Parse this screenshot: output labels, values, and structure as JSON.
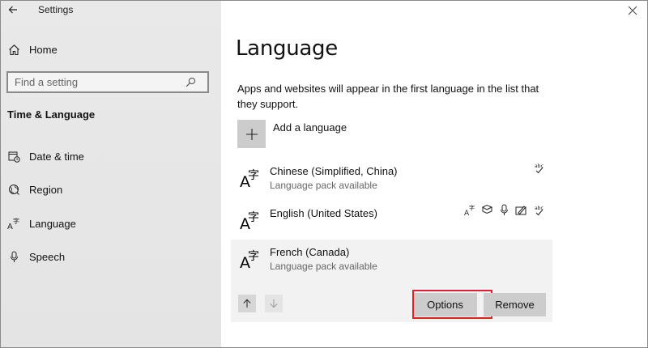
{
  "window": {
    "app_title": "Settings"
  },
  "sidebar": {
    "home_label": "Home",
    "search_placeholder": "Find a setting",
    "section_title": "Time & Language",
    "items": [
      {
        "label": "Date & time",
        "icon": "calendar-clock-icon"
      },
      {
        "label": "Region",
        "icon": "globe-icon"
      },
      {
        "label": "Language",
        "icon": "language-icon"
      },
      {
        "label": "Speech",
        "icon": "microphone-icon"
      }
    ]
  },
  "main": {
    "page_title": "Language",
    "description": "Apps and websites will appear in the first language in the list that they support.",
    "add_language_label": "Add a language",
    "languages": [
      {
        "name": "Chinese (Simplified, China)",
        "status": "Language pack available",
        "features": [
          "spelling-icon"
        ]
      },
      {
        "name": "English (United States)",
        "status": "",
        "features": [
          "display-language-icon",
          "speech-icon",
          "microphone-icon",
          "handwriting-icon",
          "spelling-icon"
        ]
      },
      {
        "name": "French (Canada)",
        "status": "Language pack available",
        "features": [],
        "selected": true
      }
    ],
    "actions": {
      "options_label": "Options",
      "remove_label": "Remove"
    }
  },
  "colors": {
    "sidebar_bg": "#e6e6e6",
    "button_bg": "#cccccc",
    "selected_row_bg": "#f2f2f2",
    "highlight": "#e0202a"
  }
}
